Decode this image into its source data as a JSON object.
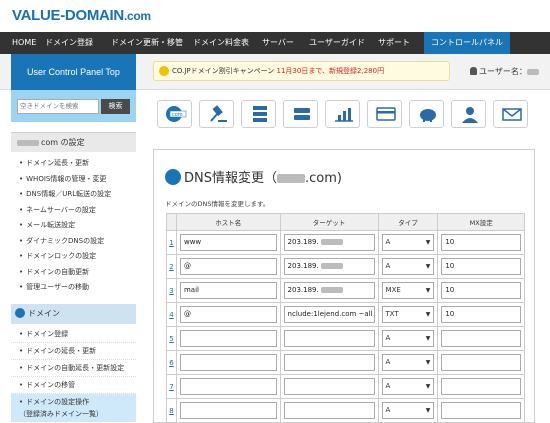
{
  "brand": {
    "logo_main": "VALUE-DOMAIN",
    "logo_suffix": ".com"
  },
  "nav": {
    "items": [
      "HOME",
      "ドメイン登録",
      "ドメイン更新・移管",
      "ドメイン料金表",
      "サーバー",
      "ユーザーガイド",
      "サポート",
      "コントロールパネル"
    ],
    "active": "コントロールパネル"
  },
  "header": {
    "panel_title": "User Control Panel Top",
    "campaign_text": "CO.JPドメイン割引キャンペーン",
    "campaign_highlight": "11月30日まで、新規登録2,280円",
    "user_label": "ユーザー名："
  },
  "sidebar": {
    "search_placeholder": "空きドメインを検索",
    "search_button": "検索",
    "domain_settings_suffix": "com の設定",
    "settings_items": [
      "ドメイン延長・更新",
      "WHOIS情報の管理・変更",
      "DNS情報／URL転送の設定",
      "ネームサーバーの設定",
      "メール転送設定",
      "ダイナミックDNSの設定",
      "ドメインロックの設定",
      "ドメインの自動更新",
      "管理ユーザーの移動"
    ],
    "domain_section_label": "ドメイン",
    "domain_items": [
      "ドメイン登録",
      "ドメインの延長・更新",
      "ドメインの自動延長・更新設定",
      "ドメインの移管",
      "ドメインの設定操作\n（登録済みドメイン一覧）"
    ]
  },
  "toolbar": {
    "icons": [
      "domain-com-icon",
      "auction-gavel-icon",
      "server-icon",
      "server-stack-icon",
      "chart-icon",
      "credit-card-icon",
      "piggy-bank-icon",
      "user-support-icon",
      "mail-icon"
    ]
  },
  "main": {
    "title_prefix": "DNS情報変更（",
    "title_suffix": ".com)",
    "description": "ドメインのDNS情報を変更します。",
    "columns": [
      "ホスト名",
      "ターゲット",
      "タイプ",
      "MX設定"
    ],
    "rows": [
      {
        "num": "1",
        "host": "www",
        "target": "203.189.",
        "type": "A",
        "mx": "10"
      },
      {
        "num": "2",
        "host": "@",
        "target": "203.189.",
        "type": "A",
        "mx": "10"
      },
      {
        "num": "3",
        "host": "mail",
        "target": "203.189.",
        "type": "MXE",
        "mx": "10"
      },
      {
        "num": "4",
        "host": "@",
        "target": "nclude:1lejend.com ~all",
        "type": "TXT",
        "mx": "10"
      },
      {
        "num": "5",
        "host": "",
        "target": "",
        "type": "A",
        "mx": ""
      },
      {
        "num": "6",
        "host": "",
        "target": "",
        "type": "A",
        "mx": ""
      },
      {
        "num": "7",
        "host": "",
        "target": "",
        "type": "A",
        "mx": ""
      },
      {
        "num": "8",
        "host": "",
        "target": "",
        "type": "A",
        "mx": ""
      }
    ]
  }
}
